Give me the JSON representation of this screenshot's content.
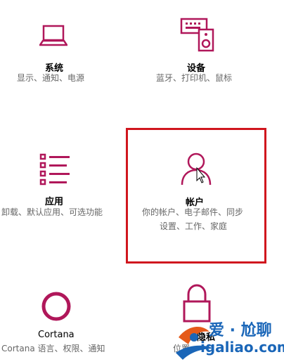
{
  "accent": "#b0175a",
  "tiles": [
    {
      "name": "system",
      "icon": "laptop-icon",
      "title": "系统",
      "subtitle": "显示、通知、电源"
    },
    {
      "name": "devices",
      "icon": "keyboard-speaker-icon",
      "title": "设备",
      "subtitle": "蓝牙、打印机、鼠标"
    },
    {
      "name": "apps",
      "icon": "app-list-icon",
      "title": "应用",
      "subtitle": "卸载、默认应用、可选功能"
    },
    {
      "name": "accounts",
      "icon": "person-icon",
      "title": "帐户",
      "subtitle_line1": "你的帐户、电子邮件、同步",
      "subtitle_line2": "设置、工作、家庭"
    },
    {
      "name": "cortana",
      "icon": "cortana-ring-icon",
      "title": "Cortana",
      "subtitle": "Cortana 语言、权限、通知"
    },
    {
      "name": "privacy",
      "icon": "lock-icon",
      "title": "隐私",
      "subtitle": "位置"
    }
  ],
  "watermark": {
    "line1": "爱 · 尬聊",
    "line2": "igaliao.com"
  }
}
